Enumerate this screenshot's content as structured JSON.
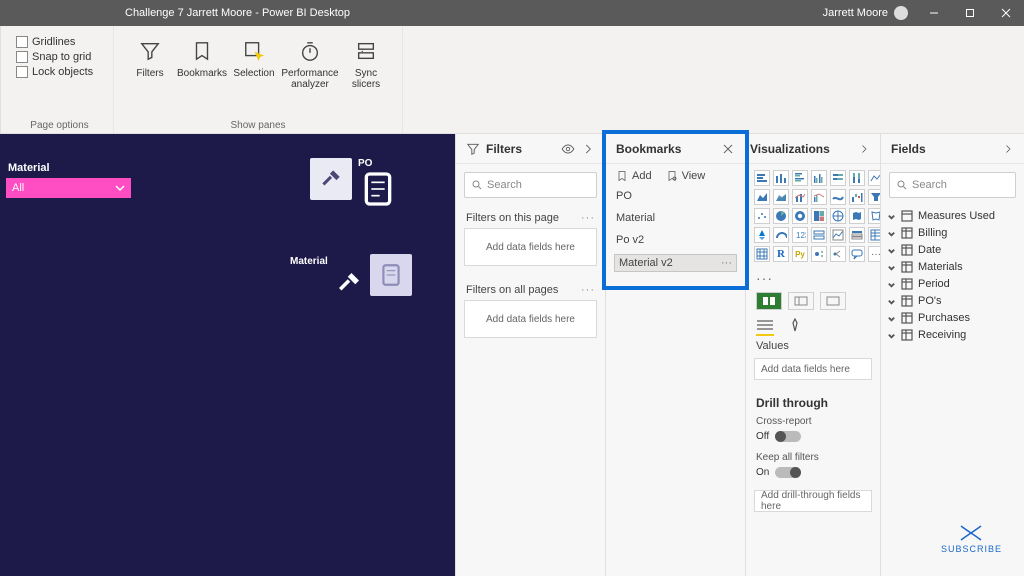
{
  "titlebar": {
    "title": "Challenge 7 Jarrett Moore - Power BI Desktop",
    "user": "Jarrett Moore"
  },
  "ribbon": {
    "page_options": {
      "gridlines": "Gridlines",
      "snap": "Snap to grid",
      "lock": "Lock objects",
      "group": "Page options"
    },
    "show_panes": {
      "filters": "Filters",
      "bookmarks": "Bookmarks",
      "selection": "Selection",
      "perf": "Performance\nanalyzer",
      "sync": "Sync\nslicers",
      "group": "Show panes"
    }
  },
  "canvas": {
    "slicer_label": "Material",
    "slicer_value": "All",
    "tile1_label": "PO",
    "tile2_label": "Material"
  },
  "filters": {
    "title": "Filters",
    "search_placeholder": "Search",
    "section_page": "Filters on this page",
    "section_all": "Filters on all pages",
    "well": "Add data fields here"
  },
  "bookmarks": {
    "title": "Bookmarks",
    "add": "Add",
    "view": "View",
    "items": [
      "PO",
      "Material",
      "Po v2",
      "Material v2"
    ]
  },
  "viz": {
    "title": "Visualizations",
    "values_label": "Values",
    "well": "Add data fields here",
    "drill_title": "Drill through",
    "cross": "Cross-report",
    "cross_state": "Off",
    "keep": "Keep all filters",
    "keep_state": "On",
    "drill_well": "Add drill-through fields here"
  },
  "fields": {
    "title": "Fields",
    "search_placeholder": "Search",
    "items": [
      "Measures Used",
      "Billing",
      "Date",
      "Materials",
      "Period",
      "PO's",
      "Purchases",
      "Receiving"
    ]
  },
  "subscribe": "SUBSCRIBE"
}
